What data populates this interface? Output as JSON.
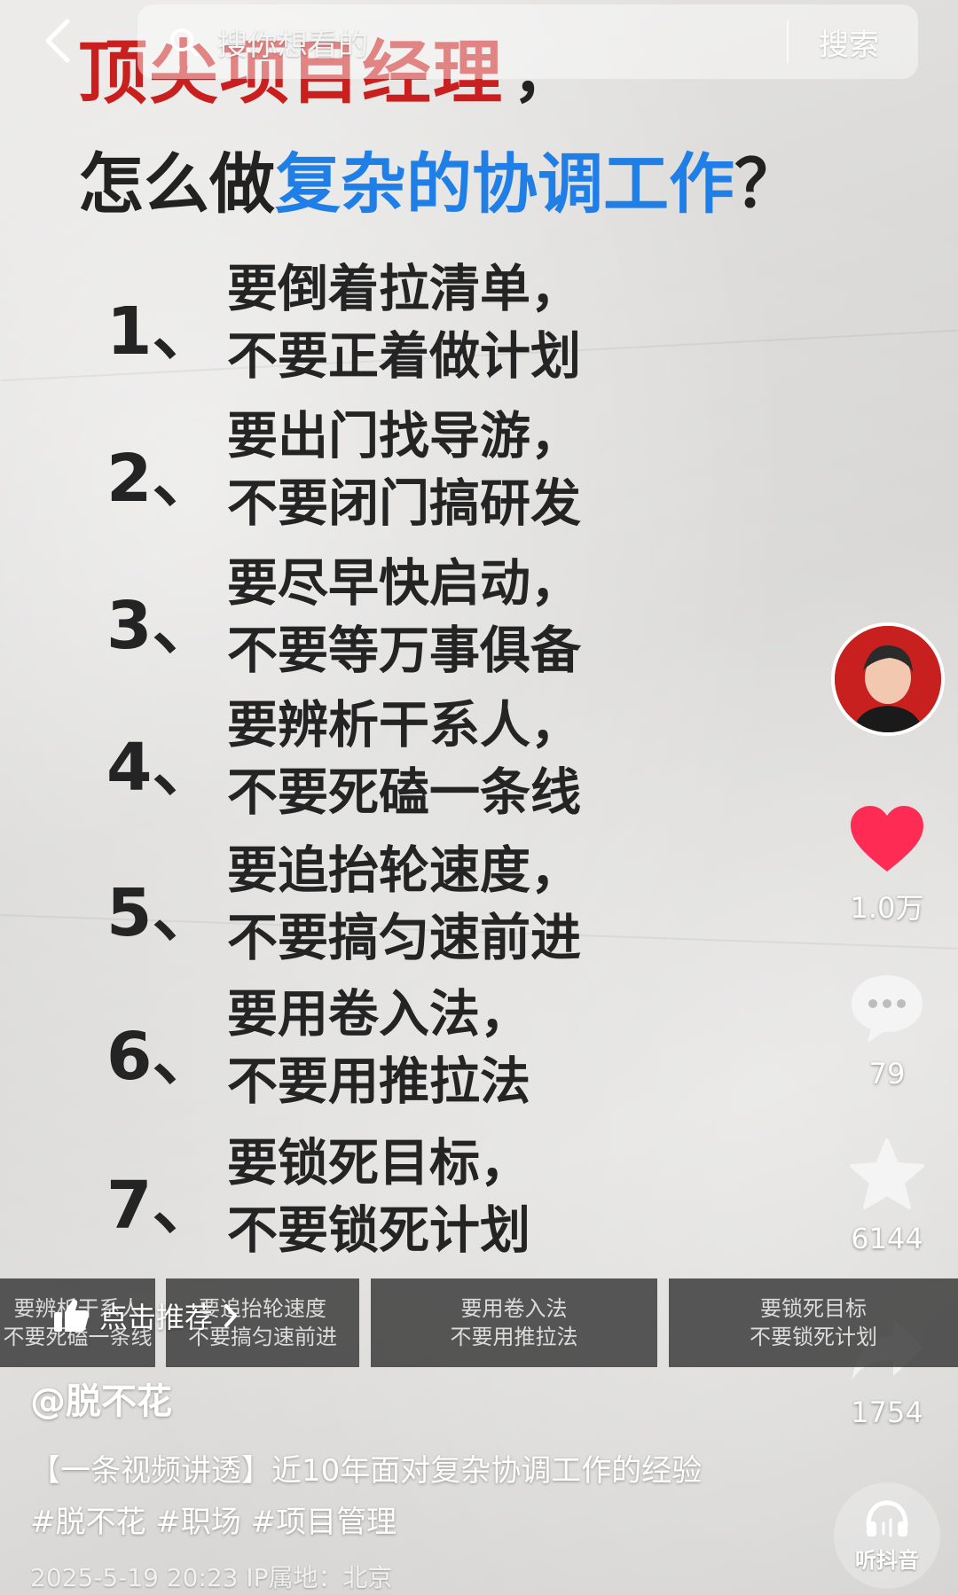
{
  "search": {
    "placeholder": "搜你想看的",
    "button": "搜索"
  },
  "title": {
    "line1": "顶尖项目经理",
    "line1_suffix": "，",
    "line2_prefix": "怎么做",
    "line2_highlight": "复杂的协调工作",
    "line2_suffix": "？"
  },
  "items": [
    {
      "num": "1、",
      "line1": "要倒着拉清单，",
      "line2": "不要正着做计划"
    },
    {
      "num": "2、",
      "line1": "要出门找导游，",
      "line2": "不要闭门搞研发"
    },
    {
      "num": "3、",
      "line1": "要尽早快启动，",
      "line2": "不要等万事俱备"
    },
    {
      "num": "4、",
      "line1": "要辨析干系人，",
      "line2": "不要死磕一条线"
    },
    {
      "num": "5、",
      "line1": "要追抬轮速度，",
      "line2": "不要搞匀速前进"
    },
    {
      "num": "6、",
      "line1": "要用卷入法，",
      "line2": "不要用推拉法"
    },
    {
      "num": "7、",
      "line1": "要锁死目标，",
      "line2": "不要锁死计划"
    }
  ],
  "rail": {
    "likes": "1.0万",
    "comments": "79",
    "favorites": "6144",
    "shares": "1754"
  },
  "chapters": [
    {
      "line1": "要辨析干系人",
      "line2": "不要死磕一条线"
    },
    {
      "line1": "要追抬轮速度",
      "line2": "不要搞匀速前进"
    },
    {
      "line1": "要用卷入法",
      "line2": "不要用推拉法"
    },
    {
      "line1": "要锁死目标",
      "line2": "不要锁死计划"
    }
  ],
  "recommend": {
    "label": "点击推荐"
  },
  "post": {
    "author": "@脱不花",
    "description": "【一条视频讲透】近10年面对复杂协调工作的经验 #脱不花 #职场 #项目管理",
    "meta": "2025-5-19 20:23 IP属地：北京"
  },
  "listen": {
    "label": "听抖音"
  },
  "colors": {
    "title_red": "#c9201f",
    "title_blue": "#1f7fe6",
    "like_red": "#fe2c55",
    "text_dark": "#242424"
  }
}
